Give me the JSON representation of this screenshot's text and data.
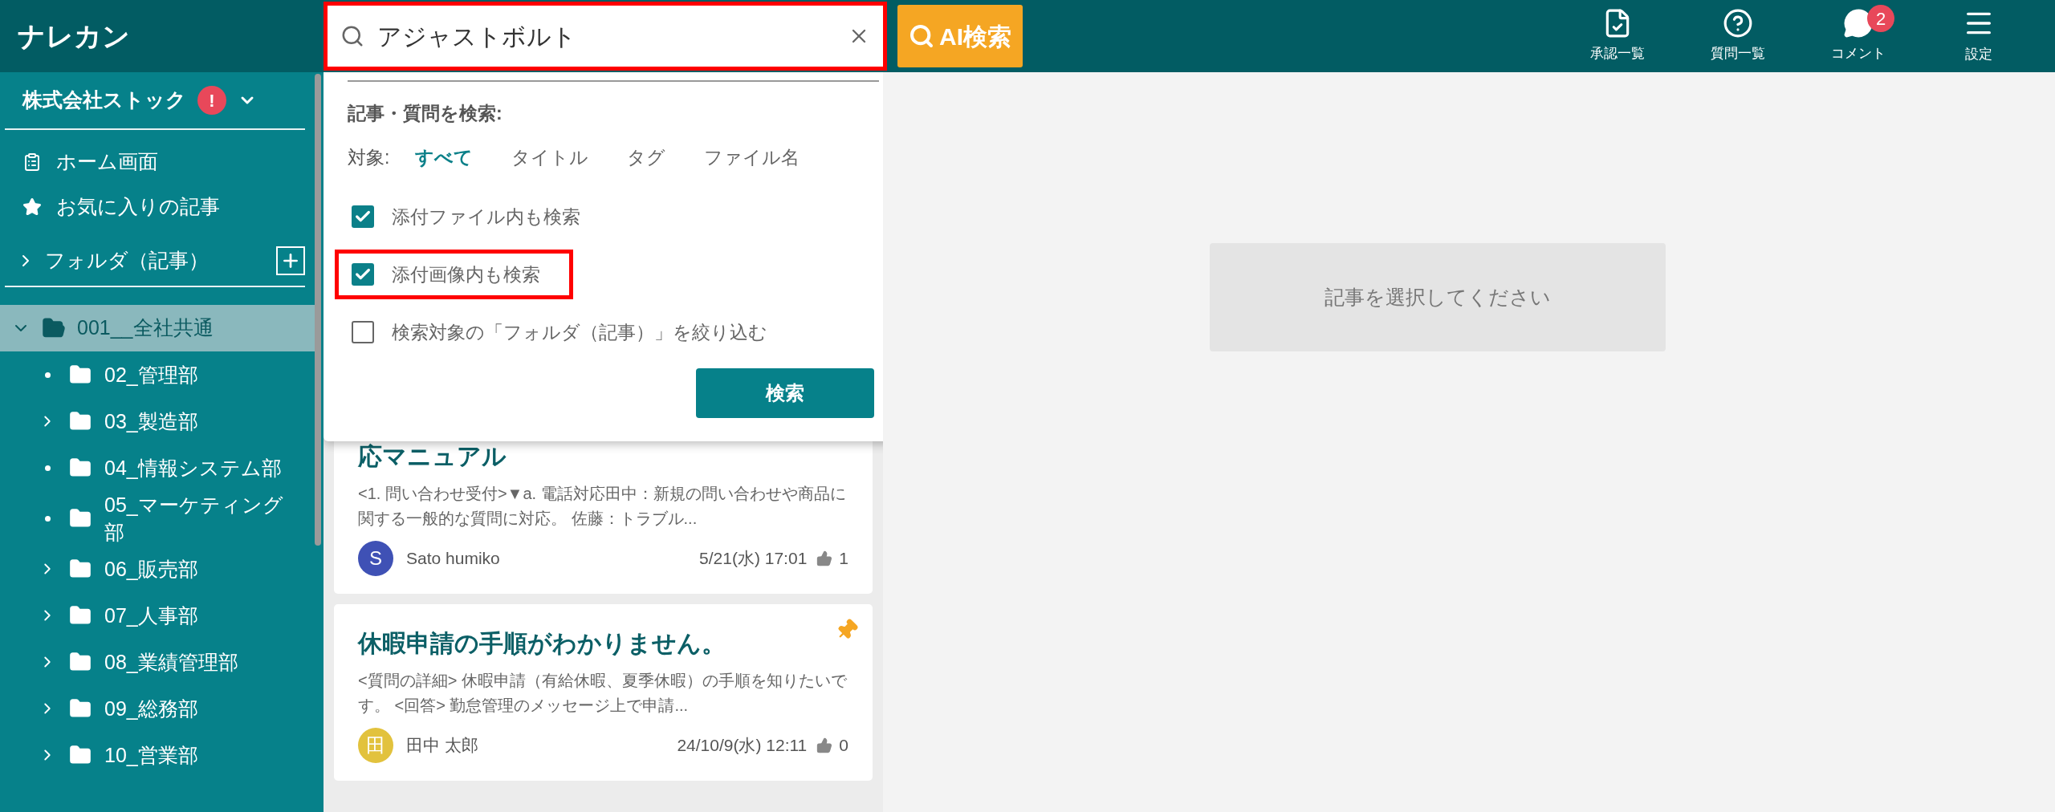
{
  "header": {
    "logo": "ナレカン",
    "search": {
      "value": "アジャストボルト",
      "highlighted": true
    },
    "ai_button": "AI検索",
    "nav": [
      {
        "label": "承認一覧",
        "kind": "approval"
      },
      {
        "label": "質問一覧",
        "kind": "questions"
      },
      {
        "label": "コメント",
        "kind": "comments",
        "badge": "2"
      },
      {
        "label": "設定",
        "kind": "settings"
      }
    ]
  },
  "sidebar": {
    "company": {
      "name": "株式会社ストック",
      "alert": "!"
    },
    "links": [
      {
        "label": "ホーム画面",
        "kind": "home"
      },
      {
        "label": "お気に入りの記事",
        "kind": "favorites"
      }
    ],
    "folder_section": {
      "label": "フォルダ（記事）",
      "expanded": false
    },
    "tree": [
      {
        "label": "001__全社共通",
        "selected": true,
        "expanded": true,
        "children": [
          {
            "label": "02_管理部",
            "selected": false,
            "expandable": false
          },
          {
            "label": "03_製造部",
            "selected": false,
            "expandable": true
          },
          {
            "label": "04_情報システム部",
            "selected": false,
            "expandable": false
          },
          {
            "label": "05_マーケティング部",
            "selected": false,
            "expandable": false
          },
          {
            "label": "06_販売部",
            "selected": false,
            "expandable": true
          },
          {
            "label": "07_人事部",
            "selected": false,
            "expandable": true
          },
          {
            "label": "08_業績管理部",
            "selected": false,
            "expandable": true
          },
          {
            "label": "09_総務部",
            "selected": false,
            "expandable": true
          },
          {
            "label": "10_営業部",
            "selected": false,
            "expandable": true
          }
        ]
      }
    ]
  },
  "search_panel": {
    "heading": "記事・質問を検索:",
    "scope_label": "対象:",
    "scopes": [
      {
        "label": "すべて",
        "selected": true
      },
      {
        "label": "タイトル",
        "selected": false
      },
      {
        "label": "タグ",
        "selected": false
      },
      {
        "label": "ファイル名",
        "selected": false
      }
    ],
    "options": [
      {
        "label": "添付ファイル内も検索",
        "checked": true,
        "highlighted": false
      },
      {
        "label": "添付画像内も検索",
        "checked": true,
        "highlighted": true
      },
      {
        "label": "検索対象の「フォルダ（記事）」を絞り込む",
        "checked": false,
        "highlighted": false
      }
    ],
    "button": "検索"
  },
  "articles": [
    {
      "title": "応マニュアル",
      "excerpt": "<1. 問い合わせ受付>▼a. 電話対応田中：新規の問い合わせや商品に関する一般的な質問に対応。 佐藤：トラブル...",
      "avatar": "S",
      "color": "#3f51b5",
      "author": "Sato humiko",
      "date": "5/21(水) 17:01",
      "likes": "1",
      "pinned": false
    },
    {
      "title": "休暇申請の手順がわかりません。",
      "excerpt": "<質問の詳細> 休暇申請（有給休暇、夏季休暇）の手順を知りたいです。 <回答> 勤怠管理のメッセージ上で申請...",
      "avatar": "田",
      "color": "#e2c23d",
      "author": "田中 太郎",
      "date": "24/10/9(水) 12:11",
      "likes": "0",
      "pinned": true
    }
  ],
  "detail": {
    "message": "記事を選択してください"
  }
}
